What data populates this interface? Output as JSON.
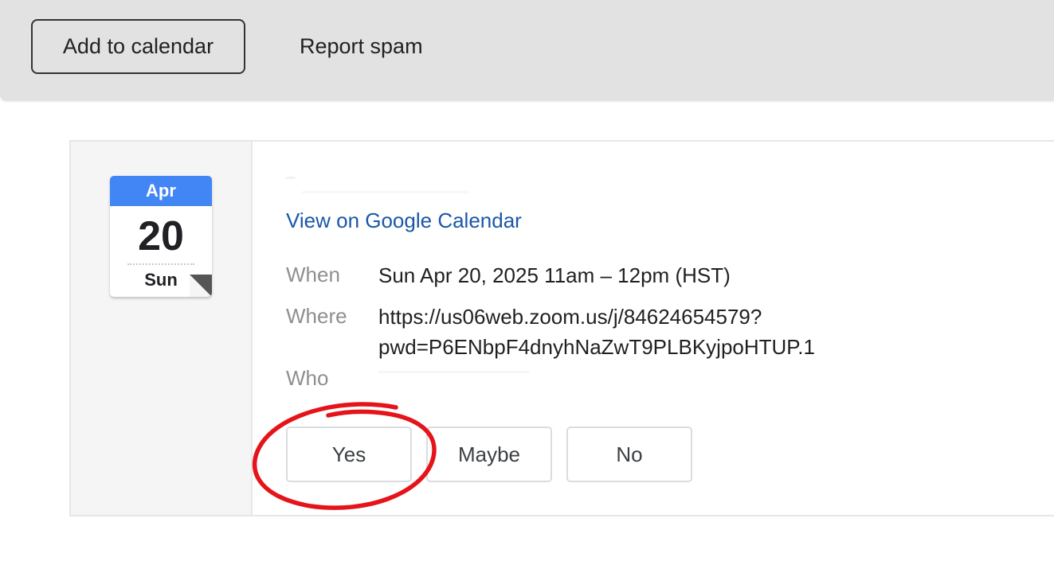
{
  "toolbar": {
    "add_to_calendar_label": "Add to calendar",
    "report_spam_label": "Report spam"
  },
  "calendar_icon": {
    "month": "Apr",
    "day": "20",
    "weekday": "Sun",
    "accent_color": "#4285f4"
  },
  "event": {
    "view_link_label": "View on Google Calendar",
    "link_color": "#1a57a8",
    "when_label": "When",
    "when_value": "Sun Apr 20, 2025 11am – 12pm (HST)",
    "where_label": "Where",
    "where_value_line1": "https://us06web.zoom.us/j/84624654579?",
    "where_value_line2": "pwd=P6ENbpF4dnyhNaZwT9PLBKyjpoHTUP.1",
    "who_label": "Who"
  },
  "rsvp": {
    "yes_label": "Yes",
    "maybe_label": "Maybe",
    "no_label": "No"
  },
  "annotation": {
    "circle_color": "#e5141b",
    "target": "rsvp-yes-button"
  }
}
